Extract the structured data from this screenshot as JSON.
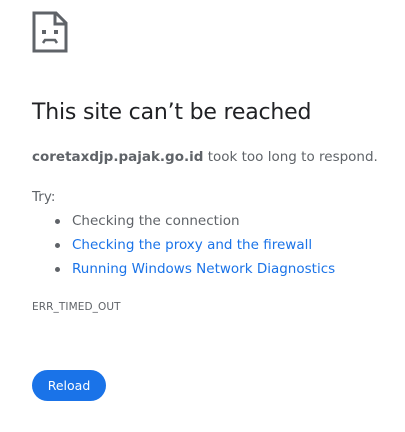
{
  "error_page": {
    "icon": "sad-page-icon",
    "title": "This site can’t be reached",
    "host": "coretaxdjp.pajak.go.id",
    "message": " took too long to respond.",
    "try_label": "Try:",
    "suggestions": [
      {
        "label": "Checking the connection",
        "is_link": false
      },
      {
        "label": "Checking the proxy and the firewall",
        "is_link": true
      },
      {
        "label": "Running Windows Network Diagnostics",
        "is_link": true
      }
    ],
    "error_code": "ERR_TIMED_OUT",
    "reload_label": "Reload"
  },
  "colors": {
    "accent": "#1a73e8",
    "text": "#202124",
    "secondary_text": "#5f6368",
    "background": "#ffffff"
  }
}
